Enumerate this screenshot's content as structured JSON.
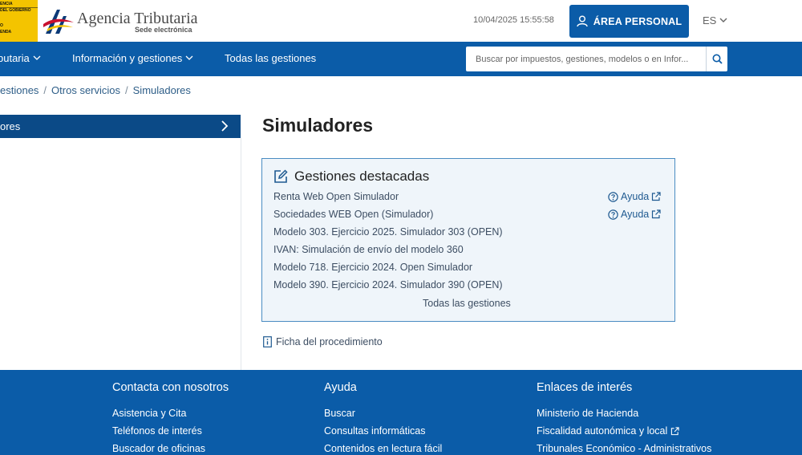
{
  "header": {
    "gov_logo_lines": [
      "ENCIA",
      "DEL GOBIERNO",
      "O",
      "ENDA"
    ],
    "brand_name": "Agencia Tributaria",
    "brand_sub": "Sede electrónica",
    "datetime": "10/04/2025 15:55:58",
    "area_personal": "ÁREA PERSONAL",
    "language": "ES",
    "colors": {
      "primary": "#0b5ca8",
      "gov_yellow": "#f4c400",
      "logo_red": "#c8102e"
    }
  },
  "nav": {
    "items": [
      "butaria",
      "Información y gestiones",
      "Todas las gestiones"
    ],
    "search_placeholder": "Buscar por impuestos, gestiones, modelos o en Infor..."
  },
  "breadcrumb": [
    "estiones",
    "Otros servicios",
    "Simuladores"
  ],
  "sidebar": {
    "active_item": "ores"
  },
  "main": {
    "title": "Simuladores",
    "featured": {
      "heading": "Gestiones destacadas",
      "items": [
        {
          "label": "Renta Web Open Simulador",
          "help": "Ayuda"
        },
        {
          "label": "Sociedades WEB Open (Simulador)",
          "help": "Ayuda"
        },
        {
          "label": "Modelo 303. Ejercicio 2025. Simulador 303 (OPEN)"
        },
        {
          "label": "IVAN: Simulación de envío del modelo 360"
        },
        {
          "label": "Modelo 718. Ejercicio 2024. Open Simulador"
        },
        {
          "label": "Modelo 390. Ejercicio 2024. Simulador 390 (OPEN)"
        }
      ],
      "all_link": "Todas las gestiones"
    },
    "ficha": "Ficha del procedimiento"
  },
  "footer": {
    "columns": [
      {
        "title": "Contacta con nosotros",
        "links": [
          "Asistencia y Cita",
          "Teléfonos de interés",
          "Buscador de oficinas"
        ]
      },
      {
        "title": "Ayuda",
        "links": [
          "Buscar",
          "Consultas informáticas",
          "Contenidos en lectura fácil"
        ]
      },
      {
        "title": "Enlaces de interés",
        "links": [
          "Ministerio de Hacienda",
          "Fiscalidad autonómica y local",
          "Tribunales Económico - Administrativos"
        ]
      }
    ]
  }
}
